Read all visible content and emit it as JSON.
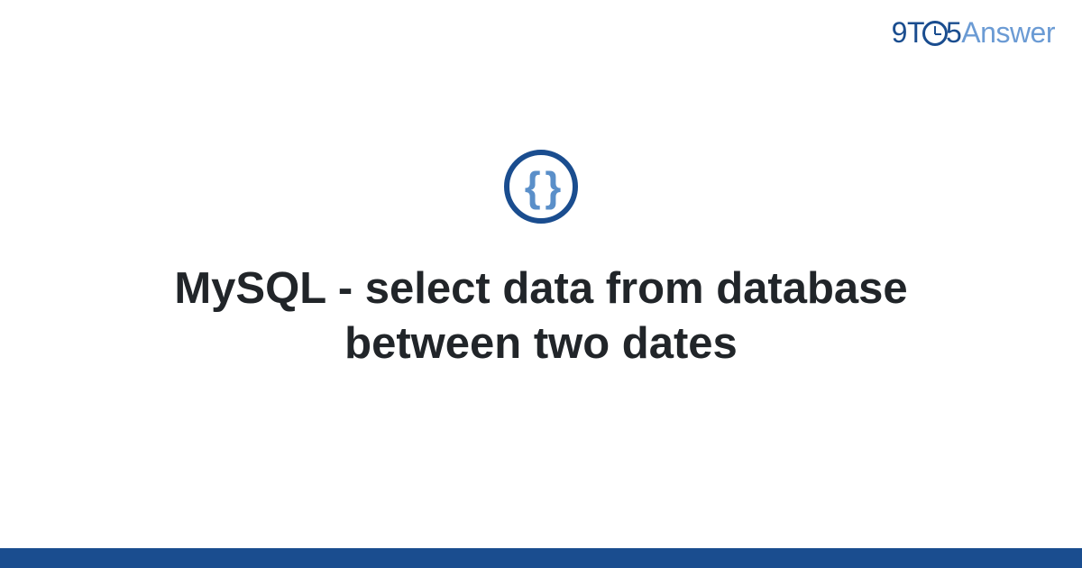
{
  "logo": {
    "part1": "9T",
    "part2": "5",
    "part3": "Answer"
  },
  "category_icon": {
    "symbol": "{ }",
    "name": "code-braces"
  },
  "title": "MySQL - select data from database between two dates",
  "colors": {
    "brand_dark": "#1a4d8f",
    "brand_light": "#6b9bd4",
    "text": "#212529"
  }
}
